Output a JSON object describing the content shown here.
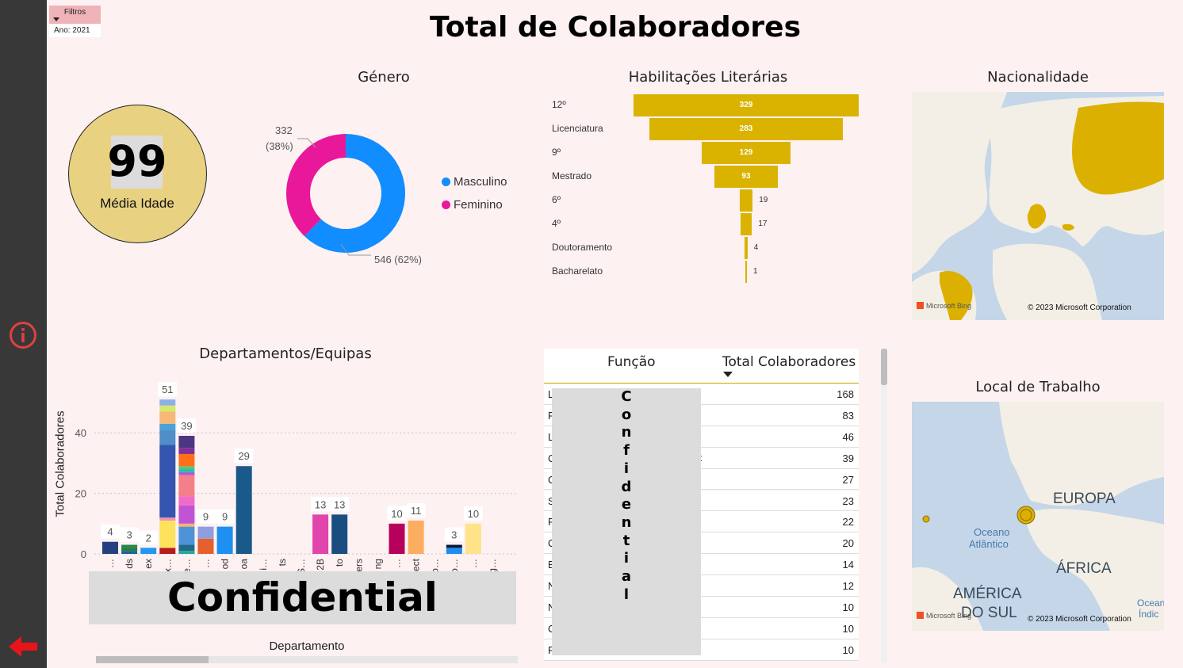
{
  "page": {
    "title": "Total de Colaboradores"
  },
  "filters": {
    "button_label": "Filtros",
    "value": "Ano: 2021"
  },
  "kpi": {
    "value": "99",
    "label": "Média Idade"
  },
  "gender": {
    "title": "Género",
    "legend": [
      {
        "label": "Masculino",
        "color": "#118dff"
      },
      {
        "label": "Feminino",
        "color": "#e9189b"
      }
    ],
    "labels": {
      "fem": "332",
      "fem_pct": "(38%)",
      "masc": "546 (62%)"
    }
  },
  "habilitacoes": {
    "title": "Habilitações Literárias",
    "items": [
      {
        "label": "12º",
        "value": "329"
      },
      {
        "label": "Licenciatura",
        "value": "283"
      },
      {
        "label": "9º",
        "value": "129"
      },
      {
        "label": "Mestrado",
        "value": "93"
      },
      {
        "label": "6º",
        "value": "19"
      },
      {
        "label": "4º",
        "value": "17"
      },
      {
        "label": "Doutoramento",
        "value": "4"
      },
      {
        "label": "Bacharelato",
        "value": "1"
      }
    ]
  },
  "nacionalidade": {
    "title": "Nacionalidade",
    "credit": "© 2023 Microsoft Corporation",
    "bing": "Microsoft Bing"
  },
  "local": {
    "title": "Local de Trabalho",
    "credit": "© 2023 Microsoft Corporation",
    "bing": "Microsoft Bing",
    "labels": {
      "europa": "EUROPA",
      "oceano1": "Oceano",
      "oceano2": "Atlântico",
      "africa": "ÁFRICA",
      "america1": "AMÉRICA",
      "america2": "DO SUL",
      "ocean_r1": "Ocean",
      "ocean_r2": "Índic"
    }
  },
  "departamentos": {
    "title": "Departamentos/Equipas",
    "xlabel": "Departamento",
    "ylabel": "Total Colaboradores",
    "overlay": "Confidential"
  },
  "funcao": {
    "header": {
      "col1": "Função",
      "col2": "Total Colaboradores"
    },
    "overlay": "C\no\nn\nf\ni\nd\ne\nn\nt\ni\na\nl",
    "rows": [
      {
        "initial": "L",
        "extra": "",
        "value": "168"
      },
      {
        "initial": "F",
        "extra": "",
        "value": "83"
      },
      {
        "initial": "L",
        "extra": "",
        "value": "46"
      },
      {
        "initial": "C",
        "extra": "t",
        "value": "39"
      },
      {
        "initial": "C",
        "extra": "",
        "value": "27"
      },
      {
        "initial": "S",
        "extra": "",
        "value": "23"
      },
      {
        "initial": "F",
        "extra": "",
        "value": "22"
      },
      {
        "initial": "C",
        "extra": "",
        "value": "20"
      },
      {
        "initial": "E",
        "extra": "",
        "value": "14"
      },
      {
        "initial": "N",
        "extra": "",
        "value": "12"
      },
      {
        "initial": "N",
        "extra": "",
        "value": "10"
      },
      {
        "initial": "C",
        "extra": "",
        "value": "10"
      },
      {
        "initial": "F",
        "extra": "",
        "value": "10"
      }
    ]
  },
  "chart_data": [
    {
      "type": "pie",
      "title": "Género",
      "slices": [
        {
          "label": "Masculino",
          "value": 546,
          "percent": 62,
          "color": "#118dff"
        },
        {
          "label": "Feminino",
          "value": 332,
          "percent": 38,
          "color": "#e9189b"
        }
      ]
    },
    {
      "type": "bar",
      "title": "Habilitações Literárias",
      "categories": [
        "12º",
        "Licenciatura",
        "9º",
        "Mestrado",
        "6º",
        "4º",
        "Doutoramento",
        "Bacharelato"
      ],
      "values": [
        329,
        283,
        129,
        93,
        19,
        17,
        4,
        1
      ]
    },
    {
      "type": "bar",
      "title": "Departamentos/Equipas",
      "xlabel": "Departamento",
      "ylabel": "Total Colaboradores",
      "ylim": [
        0,
        52
      ],
      "yticks": [
        0,
        20,
        40
      ],
      "tick_labels": [
        "…",
        "ds",
        "ex",
        "x…",
        "e…",
        "…",
        "od",
        "oa",
        "i…",
        "ts",
        "S…",
        "2B",
        "to",
        "ers",
        "ng",
        "…",
        "ect",
        "o…",
        "o…",
        "…",
        "g…"
      ],
      "bars": [
        {
          "total": 4,
          "segments": [
            [
              4,
              "#263f80"
            ]
          ]
        },
        {
          "total": 3,
          "segments": [
            [
              1,
              "#1565a0"
            ],
            [
              1,
              "#2e7d32"
            ],
            [
              1,
              "#1f8a4c"
            ]
          ]
        },
        {
          "total": 2,
          "segments": [
            [
              2,
              "#2196f3"
            ]
          ]
        },
        {
          "total": 51,
          "segments": [
            [
              2,
              "#b71c1c"
            ],
            [
              9,
              "#fde25e"
            ],
            [
              1,
              "#f48fb1"
            ],
            [
              24,
              "#3456b0"
            ],
            [
              5,
              "#4f8ec9"
            ],
            [
              2,
              "#4aa3d8"
            ],
            [
              4,
              "#f6b879"
            ],
            [
              2,
              "#d6e86b"
            ],
            [
              2,
              "#8fb0e6"
            ]
          ]
        },
        {
          "total": 39,
          "segments": [
            [
              1,
              "#26a69a"
            ],
            [
              2,
              "#1f6a86"
            ],
            [
              6,
              "#4e93d8"
            ],
            [
              1,
              "#f7b36a"
            ],
            [
              6,
              "#c154d4"
            ],
            [
              3,
              "#f06bc7"
            ],
            [
              7,
              "#f57f88"
            ],
            [
              1,
              "#ad5cd6"
            ],
            [
              1,
              "#2bbbad"
            ],
            [
              1,
              "#5bc56d"
            ],
            [
              4,
              "#ff6f1a"
            ],
            [
              2,
              "#812e97"
            ],
            [
              4,
              "#4b3682"
            ]
          ]
        },
        {
          "total": 9,
          "segments": [
            [
              5,
              "#e5602c"
            ],
            [
              4,
              "#8f9ede"
            ]
          ]
        },
        {
          "total": 9,
          "segments": [
            [
              9,
              "#1e90f2"
            ]
          ]
        },
        {
          "total": 29,
          "segments": [
            [
              29,
              "#1a5a8b"
            ]
          ]
        },
        {
          "total": 0,
          "segments": []
        },
        {
          "total": 0,
          "segments": []
        },
        {
          "total": 0,
          "segments": []
        },
        {
          "total": 13,
          "segments": [
            [
              13,
              "#df45ac"
            ]
          ]
        },
        {
          "total": 13,
          "segments": [
            [
              13,
              "#1a4d80"
            ]
          ]
        },
        {
          "total": 0,
          "segments": []
        },
        {
          "total": 0,
          "segments": []
        },
        {
          "total": 10,
          "segments": [
            [
              10,
              "#b7005c"
            ]
          ]
        },
        {
          "total": 11,
          "segments": [
            [
              11,
              "#fbae5f"
            ]
          ]
        },
        {
          "total": 0,
          "segments": []
        },
        {
          "total": 3,
          "segments": [
            [
              2,
              "#1b8ef0"
            ],
            [
              1,
              "#0a1a3a"
            ]
          ]
        },
        {
          "total": 10,
          "segments": [
            [
              10,
              "#fee389"
            ]
          ]
        },
        {
          "total": 0,
          "segments": []
        }
      ]
    },
    {
      "type": "table",
      "columns": [
        "Função",
        "Total Colaboradores"
      ],
      "values": [
        168,
        83,
        46,
        39,
        27,
        23,
        22,
        20,
        14,
        12,
        10,
        10,
        10
      ]
    }
  ]
}
